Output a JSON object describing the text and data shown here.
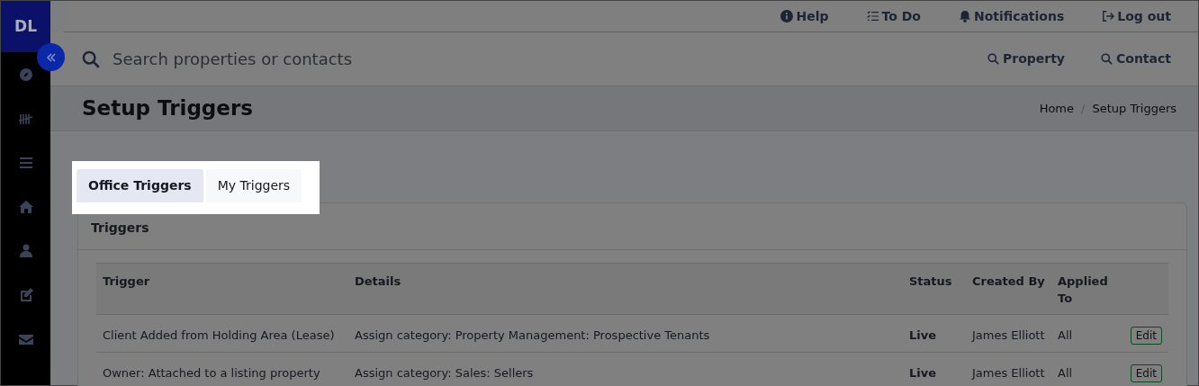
{
  "sidebar": {
    "avatar": "DL",
    "items": [
      {
        "kind": "compass"
      },
      {
        "kind": "tally"
      },
      {
        "kind": "list"
      },
      {
        "kind": "home"
      },
      {
        "kind": "person"
      },
      {
        "kind": "edit"
      },
      {
        "kind": "envelope"
      }
    ]
  },
  "top_nav": [
    {
      "kind": "info",
      "label": "Help"
    },
    {
      "kind": "todo",
      "label": "To Do"
    },
    {
      "kind": "bell",
      "label": "Notifications"
    },
    {
      "kind": "logout",
      "label": "Log out"
    }
  ],
  "search": {
    "placeholder": "Search properties or contacts",
    "buttons": [
      "Property",
      "Contact"
    ]
  },
  "page_title": "Setup Triggers",
  "breadcrumb": {
    "items": [
      "Home",
      "Setup Triggers"
    ],
    "separator": "/"
  },
  "tabs": [
    {
      "label": "Office Triggers",
      "selected": true
    },
    {
      "label": "My Triggers",
      "selected": false
    }
  ],
  "card_title": "Triggers",
  "table": {
    "columns": [
      "Trigger",
      "Details",
      "Status",
      "Created By",
      "Applied To"
    ],
    "rows": [
      {
        "trigger": "Client Added from Holding Area (Lease)",
        "details": "Assign category: Property Management: Prospective Tenants",
        "status": "Live",
        "created_by": "James Elliott",
        "applied_to": "All",
        "action": "Edit"
      },
      {
        "trigger": "Owner: Attached to a listing property",
        "details": "Assign category: Sales: Sellers",
        "status": "Live",
        "created_by": "James Elliott",
        "applied_to": "All",
        "action": "Edit"
      }
    ]
  }
}
